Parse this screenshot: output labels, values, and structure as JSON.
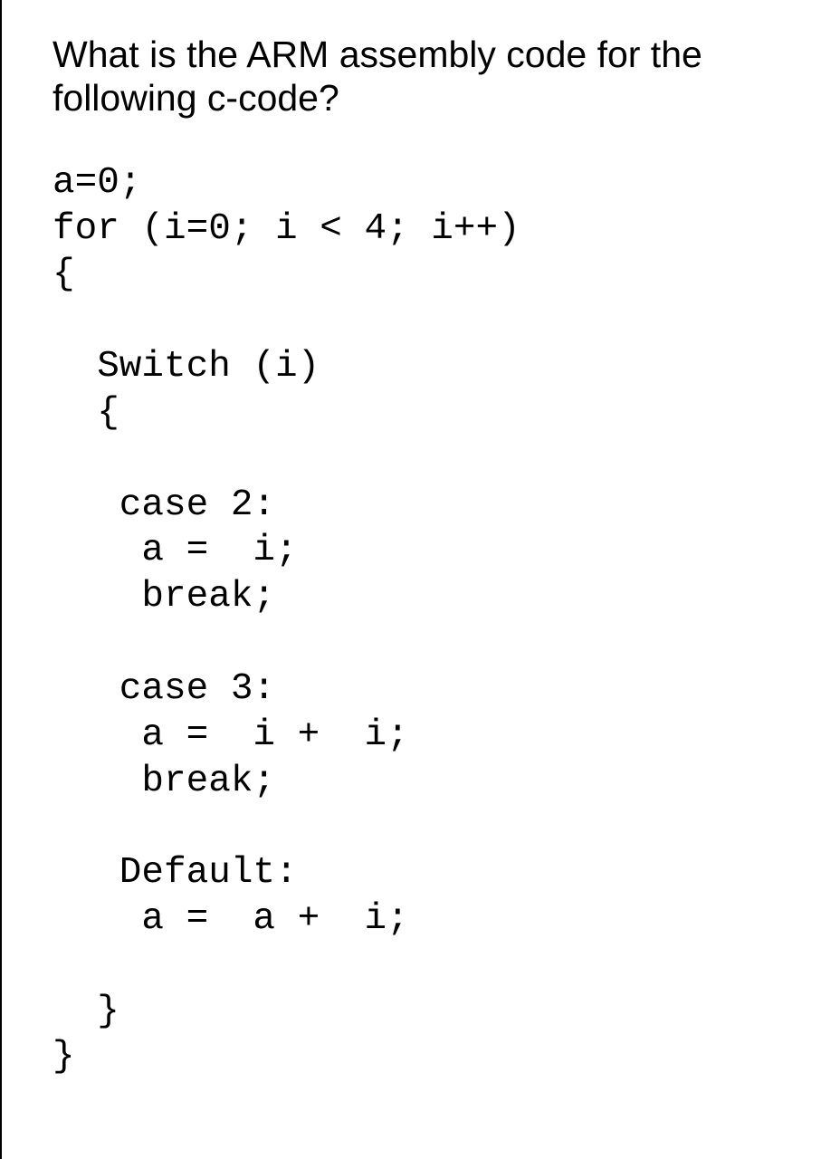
{
  "question": "What is the ARM assembly code for the following c-code?",
  "code_lines": [
    "a=0;",
    "for (i=0; i < 4; i++)",
    "{",
    "",
    "  Switch (i)",
    "  {",
    "",
    "   case 2:",
    "    a =  i;",
    "    break;",
    "",
    "   case 3:",
    "    a =  i +  i;",
    "    break;",
    "",
    "   Default:",
    "    a =  a +  i;",
    "",
    "  }",
    "}"
  ]
}
